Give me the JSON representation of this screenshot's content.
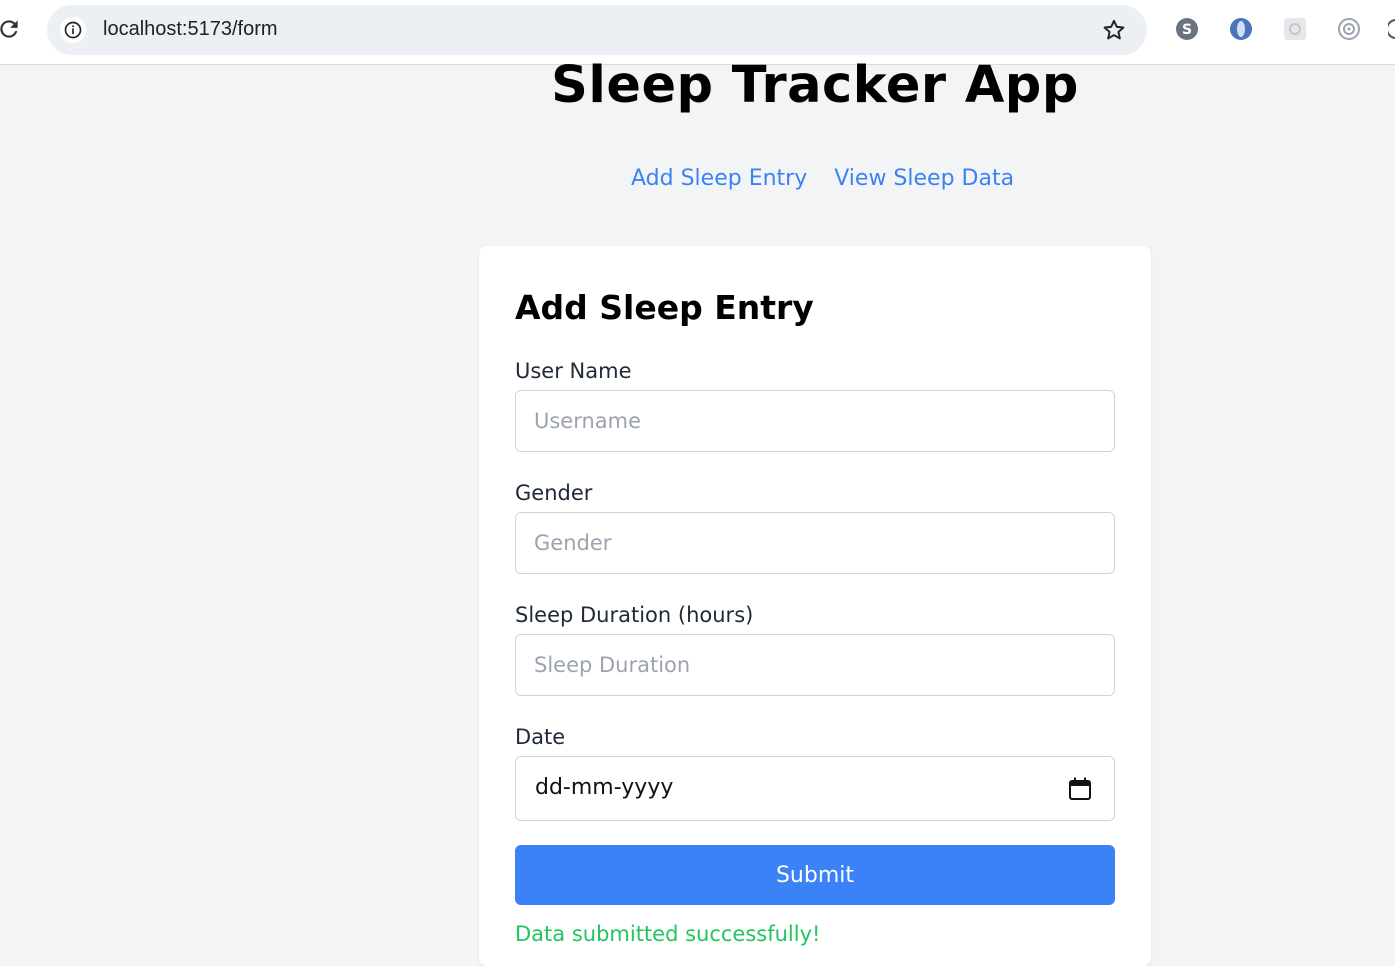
{
  "browser": {
    "url": "localhost:5173/form",
    "icons": [
      "reload-icon",
      "site-info-icon",
      "bookmark-star-icon",
      "skype-extension-icon",
      "vpn-extension-icon",
      "gear-extension-icon",
      "target-extension-icon"
    ]
  },
  "app": {
    "title": "Sleep Tracker App",
    "nav": {
      "add_entry": "Add Sleep Entry",
      "view_data": "View Sleep Data"
    }
  },
  "form": {
    "title": "Add Sleep Entry",
    "username": {
      "label": "User Name",
      "placeholder": "Username",
      "value": ""
    },
    "gender": {
      "label": "Gender",
      "placeholder": "Gender",
      "value": ""
    },
    "duration": {
      "label": "Sleep Duration (hours)",
      "placeholder": "Sleep Duration",
      "value": ""
    },
    "date": {
      "label": "Date",
      "placeholder": "dd-mm-yyyy"
    },
    "submit_label": "Submit",
    "success_message": "Data submitted successfully!"
  },
  "colors": {
    "accent": "#3b82f6",
    "success": "#22c55e",
    "page_bg": "#f3f4f6"
  }
}
